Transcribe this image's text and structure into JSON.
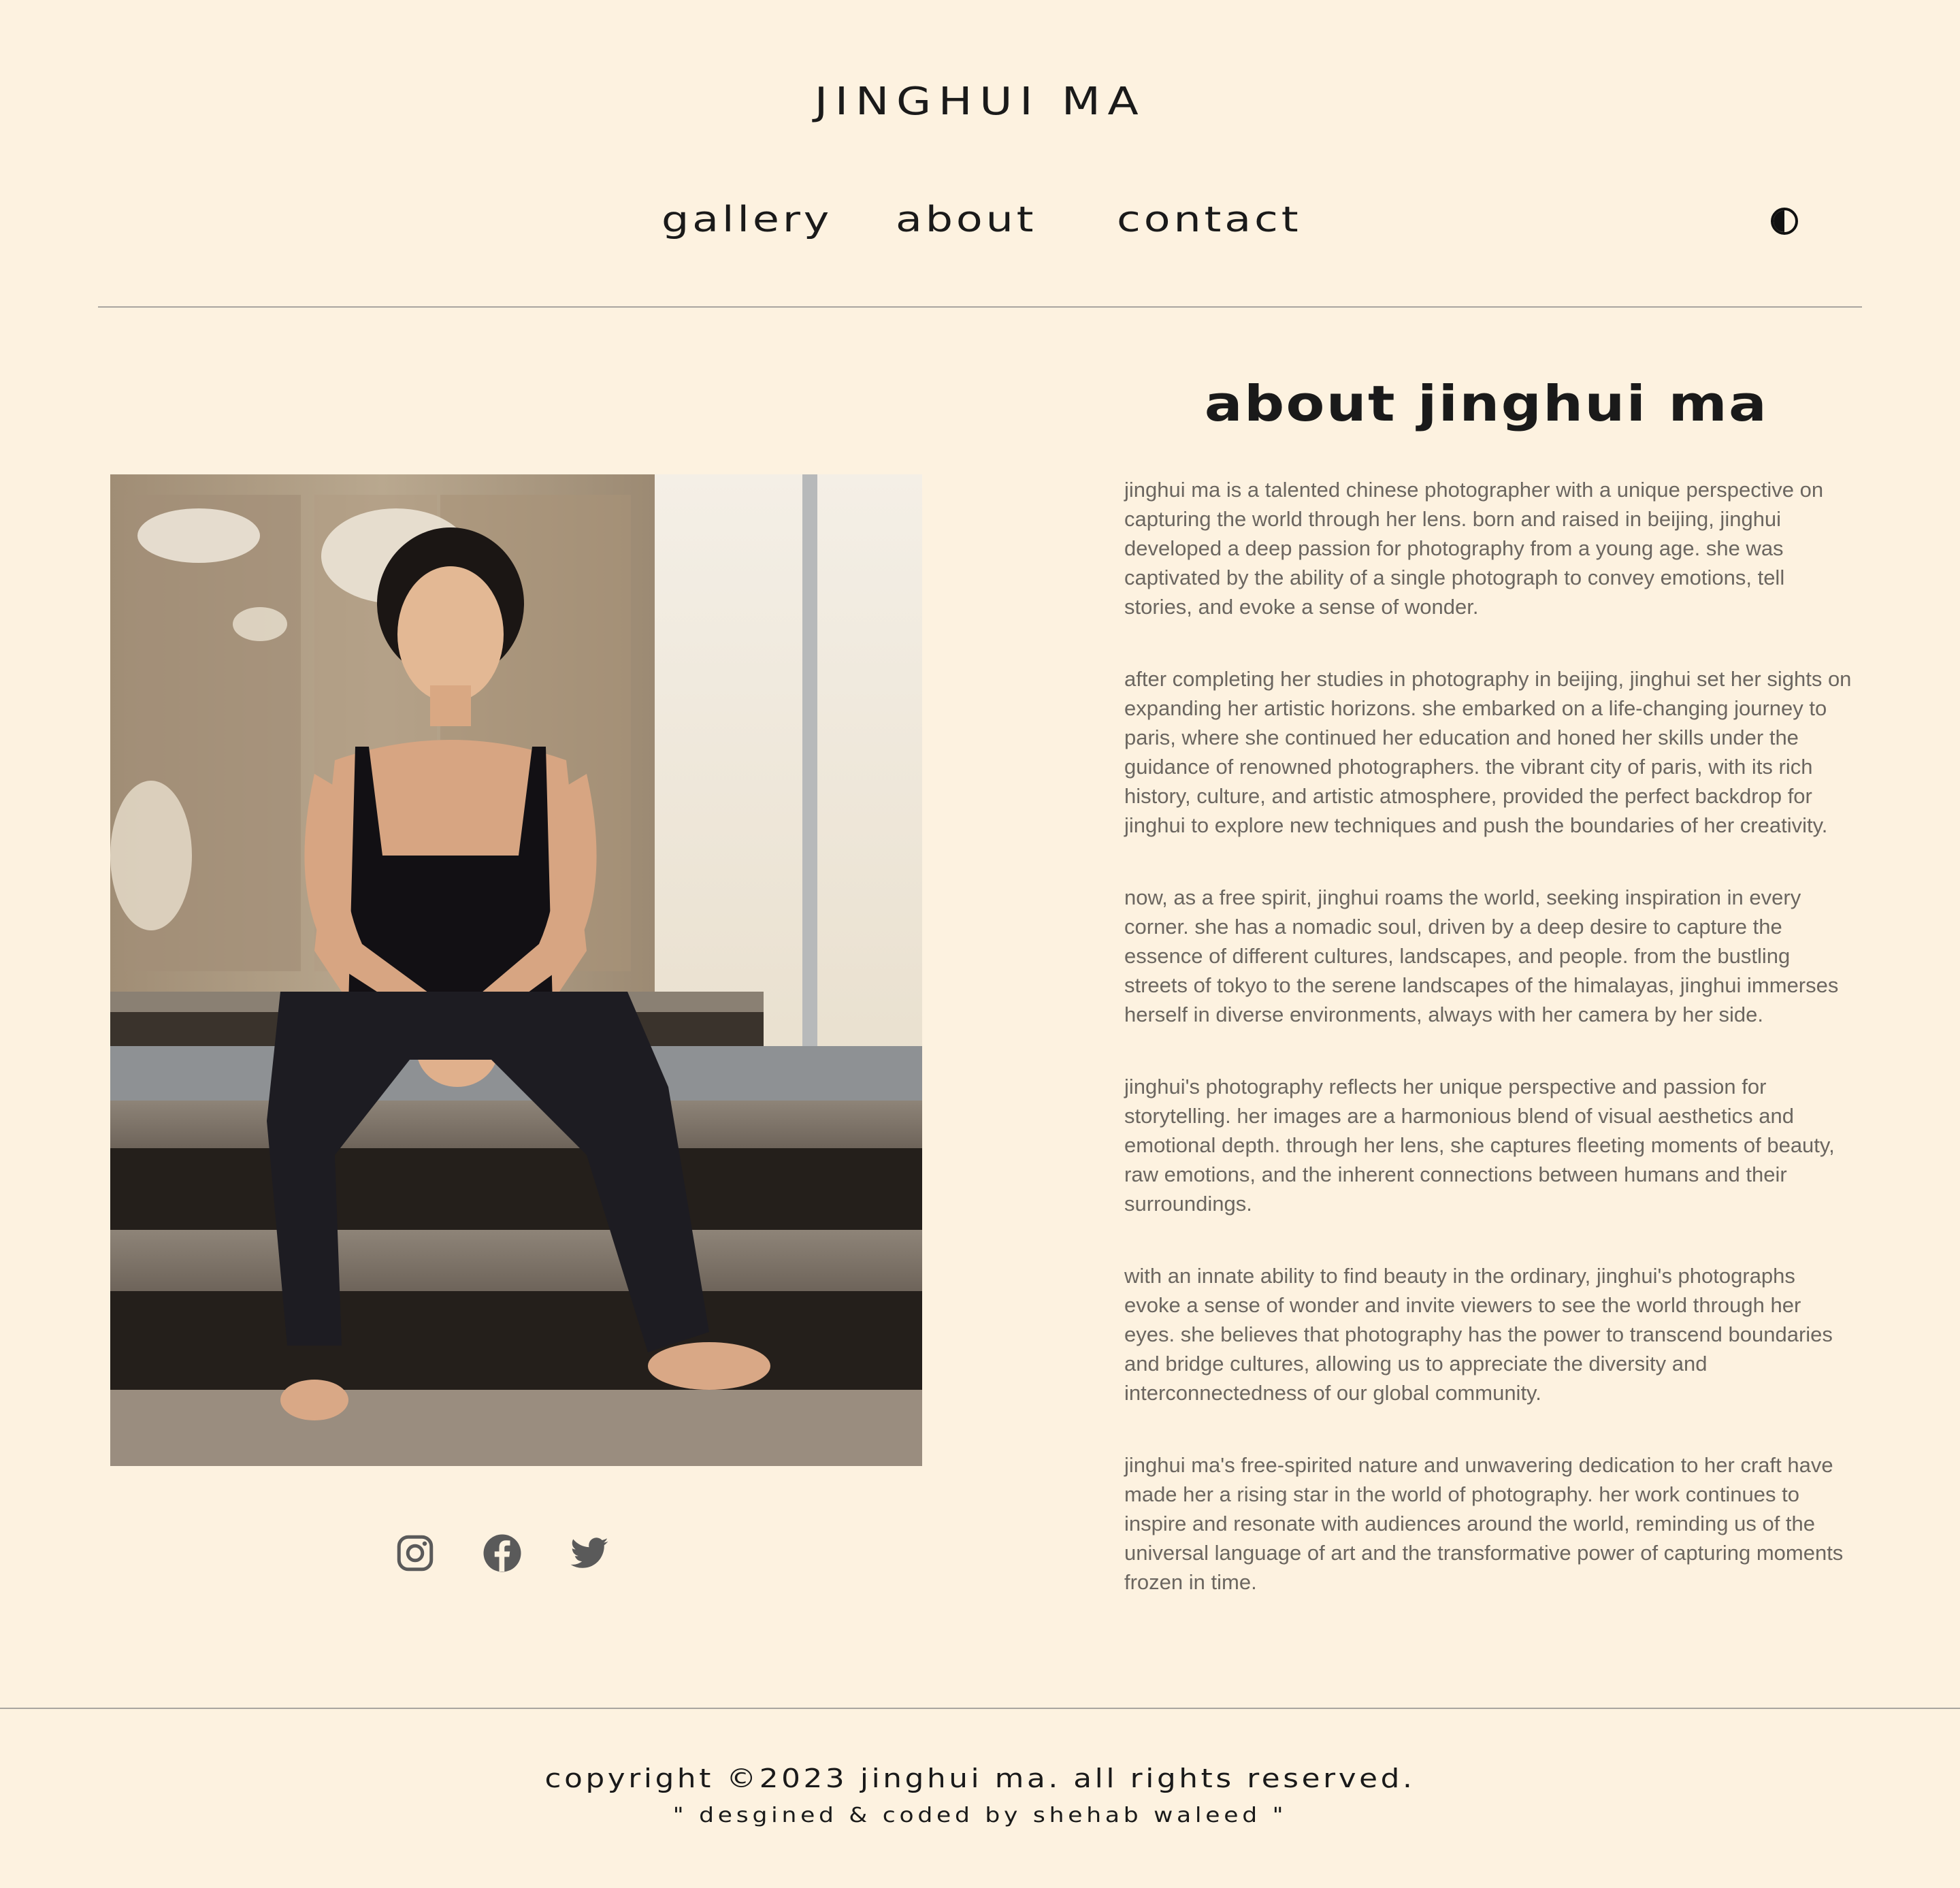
{
  "header": {
    "site_title": "JINGHUI MA",
    "nav": [
      {
        "label": "gallery"
      },
      {
        "label": "about"
      },
      {
        "label": "contact"
      }
    ],
    "theme_toggle_icon": "half-circle-icon"
  },
  "main": {
    "heading": "about jinghui ma",
    "paragraphs": [
      "jinghui ma is a talented chinese photographer with a unique perspective on capturing the world through her lens. born and raised in beijing, jinghui developed a deep passion for photography from a young age. she was captivated by the ability of a single photograph to convey emotions, tell stories, and evoke a sense of wonder.",
      "after completing her studies in photography in beijing, jinghui set her sights on expanding her artistic horizons. she embarked on a life-changing journey to paris, where she continued her education and honed her skills under the guidance of renowned photographers. the vibrant city of paris, with its rich history, culture, and artistic atmosphere, provided the perfect backdrop for jinghui to explore new techniques and push the boundaries of her creativity.",
      "now, as a free spirit, jinghui roams the world, seeking inspiration in every corner. she has a nomadic soul, driven by a deep desire to capture the essence of different cultures, landscapes, and people. from the bustling streets of tokyo to the serene landscapes of the himalayas, jinghui immerses herself in diverse environments, always with her camera by her side.",
      "jinghui's photography reflects her unique perspective and passion for storytelling. her images are a harmonious blend of visual aesthetics and emotional depth. through her lens, she captures fleeting moments of beauty, raw emotions, and the inherent connections between humans and their surroundings.",
      "with an innate ability to find beauty in the ordinary, jinghui's photographs evoke a sense of wonder and invite viewers to see the world through her eyes. she believes that photography has the power to transcend boundaries and bridge cultures, allowing us to appreciate the diversity and interconnectedness of our global community.",
      "jinghui ma's free-spirited nature and unwavering dedication to her craft have made her a rising star in the world of photography. her work continues to inspire and resonate with audiences around the world, reminding us of the universal language of art and the transformative power of capturing moments frozen in time."
    ],
    "social_icons": [
      "instagram-icon",
      "facebook-icon",
      "twitter-icon"
    ]
  },
  "footer": {
    "copyright": "copyright ©2023 jinghui ma. all rights reserved.",
    "credit": "\" desgined & coded by shehab waleed \""
  },
  "colors": {
    "background": "#fdf2e0",
    "text_dark": "#1a1a1a",
    "text_body": "#6b6660",
    "rule": "#a9a59f",
    "icon": "#5a5a5a"
  }
}
